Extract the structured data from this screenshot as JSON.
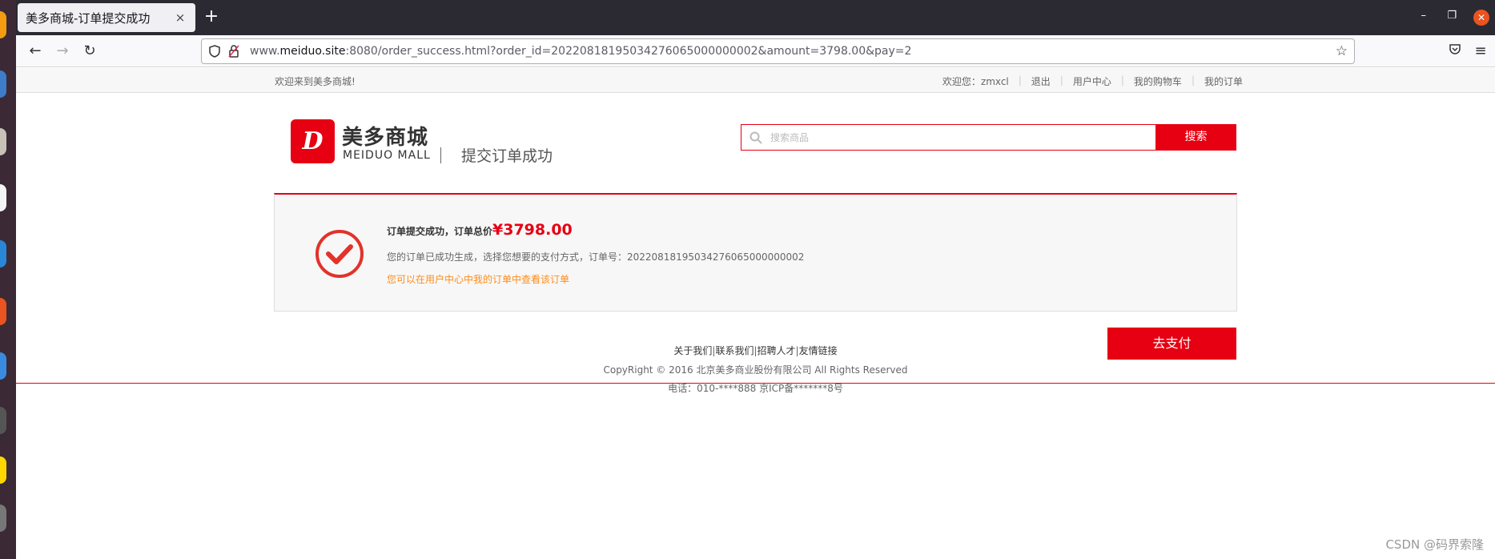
{
  "browser": {
    "tab_title": "美多商城-订单提交成功",
    "tab_close": "×",
    "new_tab": "+",
    "url_host_prefix": "www.",
    "url_host": "meiduo.site",
    "url_rest": ":8080/order_success.html?order_id=20220818195034276065000000002&amount=3798.00&pay=2"
  },
  "topbar": {
    "welcome": "欢迎来到美多商城!",
    "user_greeting": "欢迎您：",
    "username": "zmxcl",
    "logout": "退出",
    "user_center": "用户中心",
    "cart": "我的购物车",
    "orders": "我的订单"
  },
  "header": {
    "logo_cn": "美多商城",
    "logo_en": "MEIDUO MALL",
    "page_subtitle": "提交订单成功",
    "search_placeholder": "搜索商品",
    "search_button": "搜索"
  },
  "success": {
    "line1_prefix": "订单提交成功，订单总价",
    "total_price": "¥3798.00",
    "line2": "您的订单已成功生成，选择您想要的支付方式，订单号：20220818195034276065000000002",
    "line3": "您可以在用户中心中我的订单中查看该订单",
    "pay_button": "去支付"
  },
  "footer": {
    "links": [
      "关于我们",
      "联系我们",
      "招聘人才",
      "友情链接"
    ],
    "copyright": "CopyRight © 2016 北京美多商业股份有限公司 All Rights Reserved",
    "tel": "电话：010-****888 京ICP备*******8号"
  },
  "watermark": "CSDN @码界索隆",
  "colors": {
    "accent": "#e60012",
    "orange_link": "#ff8c1a"
  }
}
